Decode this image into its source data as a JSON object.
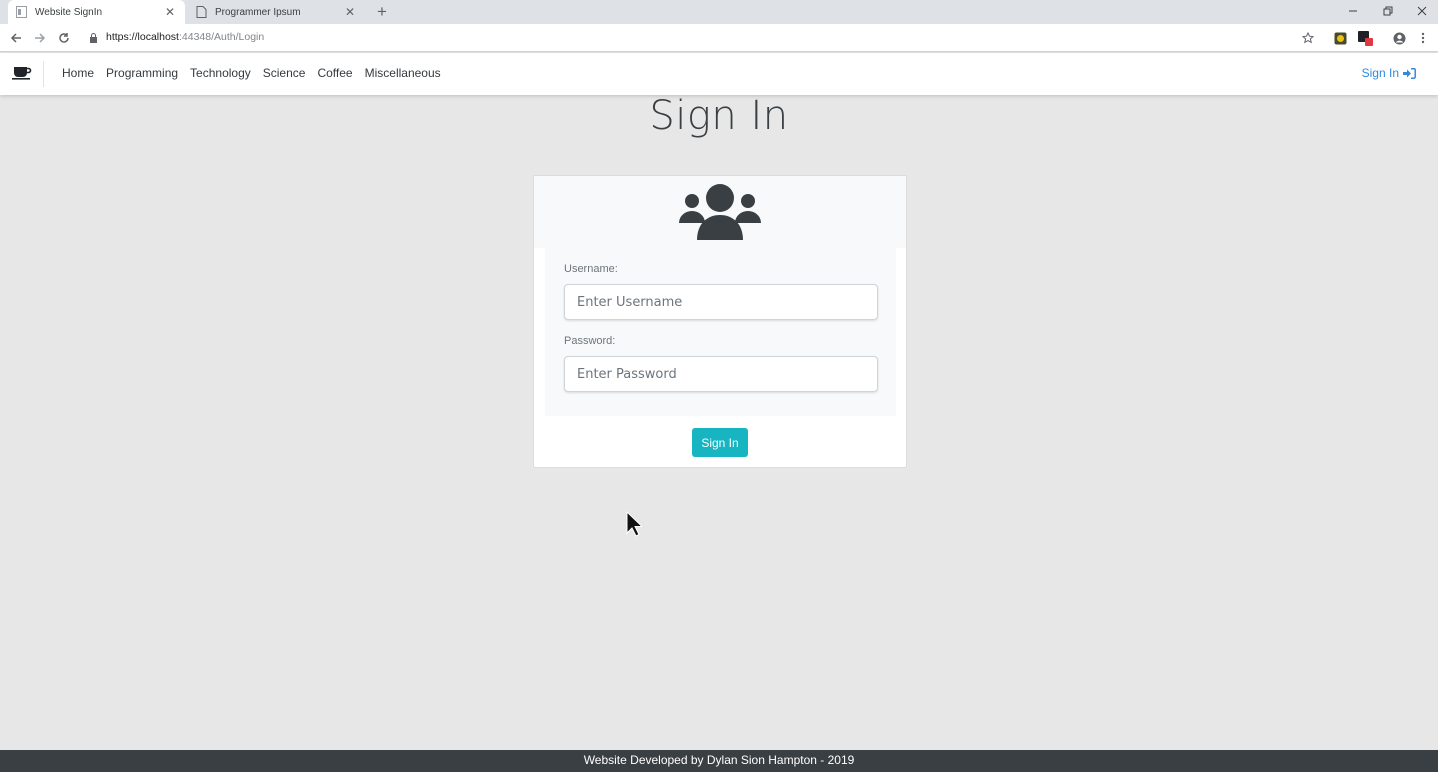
{
  "browser": {
    "tabs": [
      {
        "title": "Website SignIn",
        "active": true
      },
      {
        "title": "Programmer Ipsum",
        "active": false
      }
    ],
    "new_tab_label": "+",
    "url_host": "https://localhost",
    "url_path": ":44348/Auth/Login"
  },
  "navbar": {
    "brand_icon": "coffee-icon",
    "links": [
      "Home",
      "Programming",
      "Technology",
      "Science",
      "Coffee",
      "Miscellaneous"
    ],
    "signin_label": "Sign In"
  },
  "main": {
    "title": "Sign In",
    "card_icon": "users-icon",
    "username_label": "Username:",
    "username_placeholder": "Enter Username",
    "password_label": "Password:",
    "password_placeholder": "Enter Password",
    "submit_label": "Sign In"
  },
  "footer": {
    "text": "Website Developed by Dylan Sion Hampton - 2019"
  },
  "colors": {
    "accent_teal": "#17b5c2",
    "link_blue": "#2f8ae0",
    "footer_bg": "#3a3f44",
    "page_bg": "#e6e7e6"
  }
}
